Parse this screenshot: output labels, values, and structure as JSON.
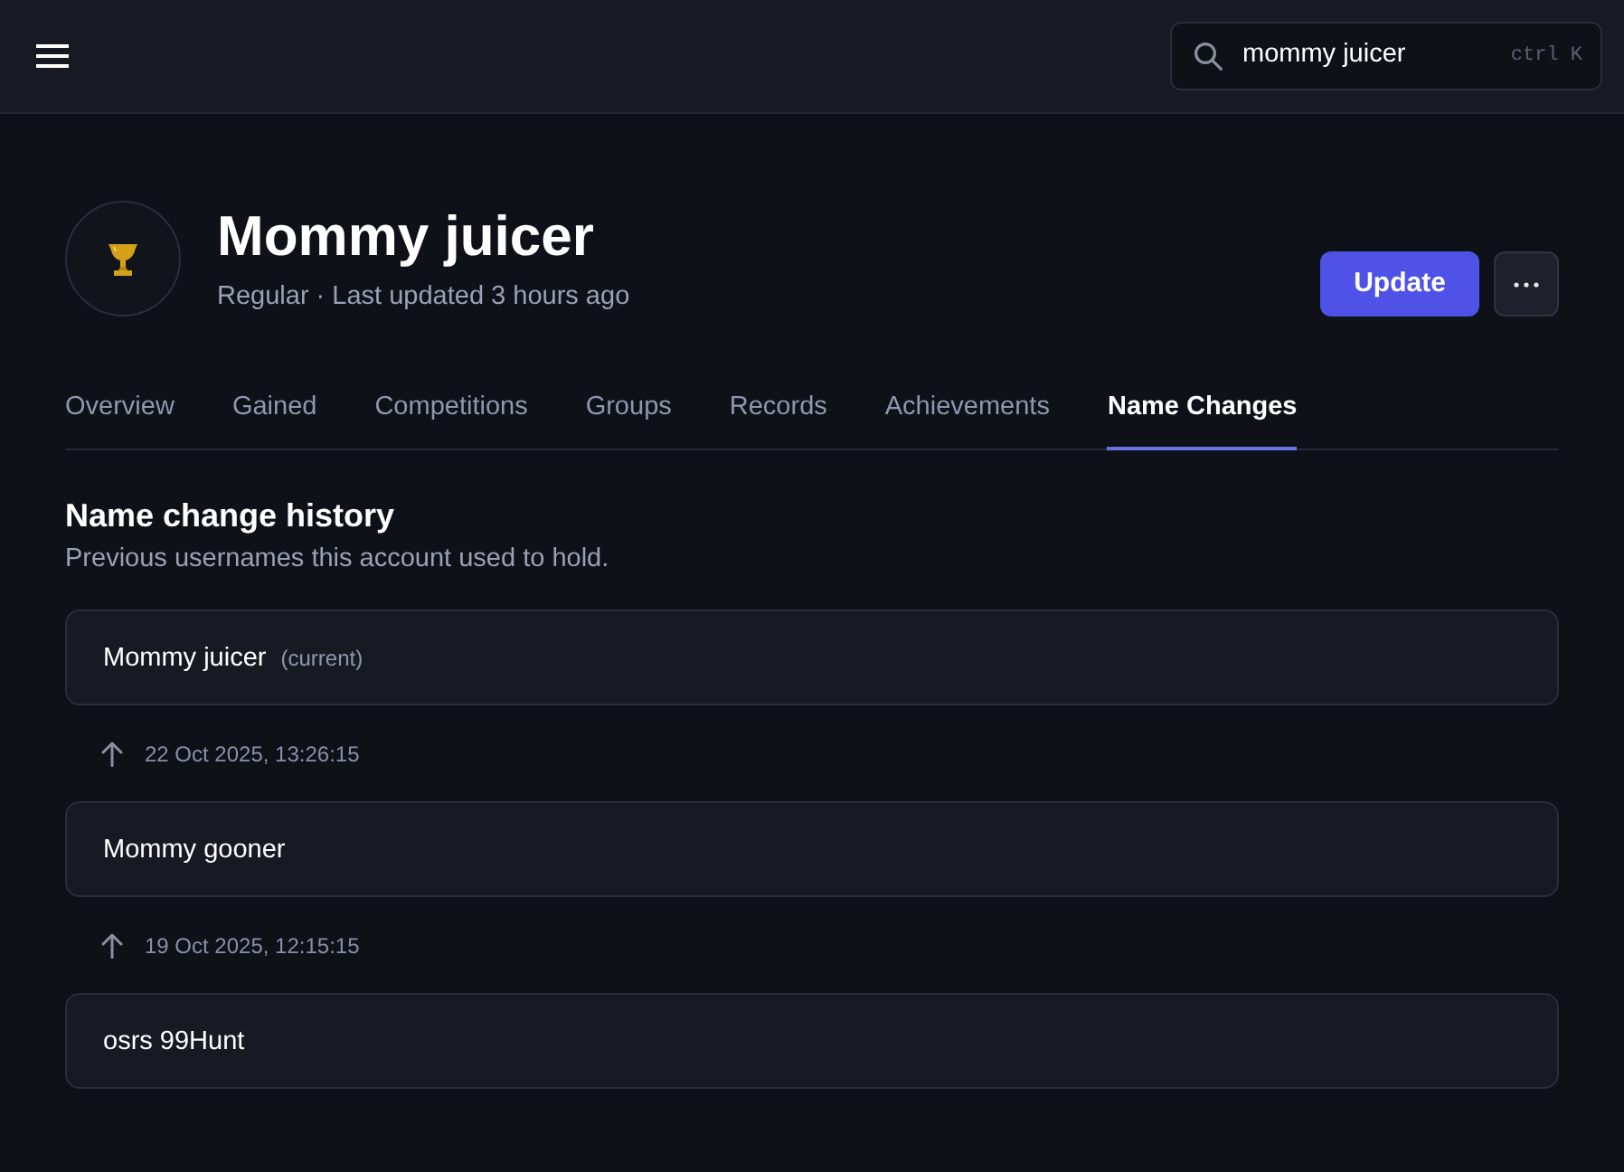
{
  "header": {
    "search": {
      "value": "mommy juicer",
      "shortcut": "ctrl K"
    }
  },
  "profile": {
    "name": "Mommy juicer",
    "subtitle": "Regular · Last updated 3 hours ago",
    "actions": {
      "update": "Update"
    }
  },
  "tabs": [
    {
      "label": "Overview",
      "selected": false
    },
    {
      "label": "Gained",
      "selected": false
    },
    {
      "label": "Competitions",
      "selected": false
    },
    {
      "label": "Groups",
      "selected": false
    },
    {
      "label": "Records",
      "selected": false
    },
    {
      "label": "Achievements",
      "selected": false
    },
    {
      "label": "Name Changes",
      "selected": true
    }
  ],
  "section": {
    "title": "Name change history",
    "description": "Previous usernames this account used to hold."
  },
  "name_changes": [
    {
      "name": "Mommy juicer",
      "note": "(current)",
      "changed_at": "22 Oct 2025, 13:26:15"
    },
    {
      "name": "Mommy gooner",
      "changed_at": "19 Oct 2025, 12:15:15"
    },
    {
      "name": "osrs 99Hunt"
    }
  ]
}
